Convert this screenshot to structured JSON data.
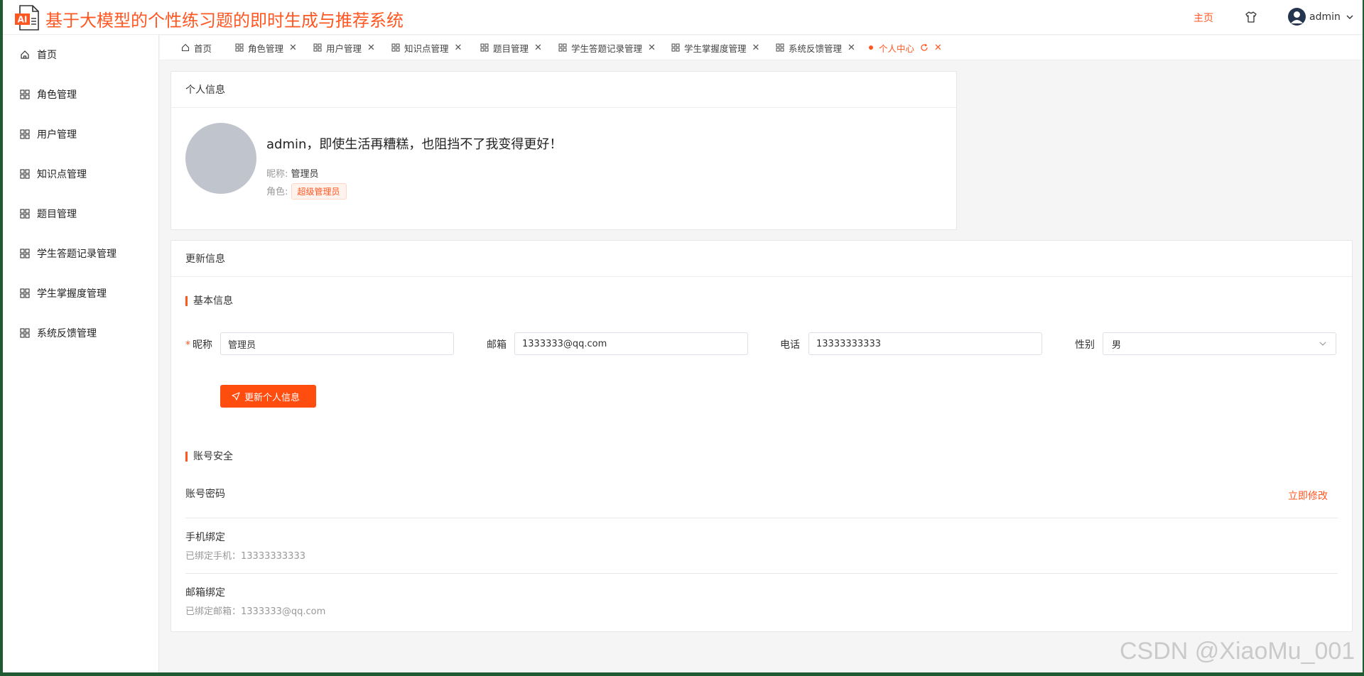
{
  "header": {
    "title": "基于大模型的个性练习题的即时生成与推荐系统",
    "logo_text": "AI",
    "nav_home": "主页",
    "user_name": "admin"
  },
  "sidebar": {
    "items": [
      {
        "label": "首页",
        "icon": "home-icon"
      },
      {
        "label": "角色管理",
        "icon": "grid-icon"
      },
      {
        "label": "用户管理",
        "icon": "grid-icon"
      },
      {
        "label": "知识点管理",
        "icon": "grid-icon"
      },
      {
        "label": "题目管理",
        "icon": "grid-icon"
      },
      {
        "label": "学生答题记录管理",
        "icon": "grid-icon"
      },
      {
        "label": "学生掌握度管理",
        "icon": "grid-icon"
      },
      {
        "label": "系统反馈管理",
        "icon": "grid-icon"
      }
    ]
  },
  "tabs": [
    {
      "label": "首页"
    },
    {
      "label": "角色管理"
    },
    {
      "label": "用户管理"
    },
    {
      "label": "知识点管理"
    },
    {
      "label": "题目管理"
    },
    {
      "label": "学生答题记录管理"
    },
    {
      "label": "学生掌握度管理"
    },
    {
      "label": "系统反馈管理"
    },
    {
      "label": "个人中心",
      "active": true
    }
  ],
  "profile": {
    "card_title": "个人信息",
    "motto": "admin，即使生活再糟糕，也阻挡不了我变得更好！",
    "nickname_label": "昵称:",
    "nickname": "管理员",
    "role_label": "角色:",
    "role": "超级管理员"
  },
  "update": {
    "card_title": "更新信息",
    "basic_title": "基本信息",
    "nickname_label": "昵称",
    "nickname_value": "管理员",
    "email_label": "邮箱",
    "email_value": "1333333@qq.com",
    "phone_label": "电话",
    "phone_value": "13333333333",
    "gender_label": "性别",
    "gender_value": "男",
    "submit_label": "更新个人信息",
    "security_title": "账号安全",
    "password_title": "账号密码",
    "password_action": "立即修改",
    "phone_bind_title": "手机绑定",
    "phone_bind_text": "已绑定手机：13333333333",
    "email_bind_title": "邮箱绑定",
    "email_bind_text": "已绑定邮箱：1333333@qq.com"
  },
  "watermark": "CSDN @XiaoMu_001",
  "colors": {
    "accent": "#ff5722",
    "button": "#ff4d10"
  }
}
